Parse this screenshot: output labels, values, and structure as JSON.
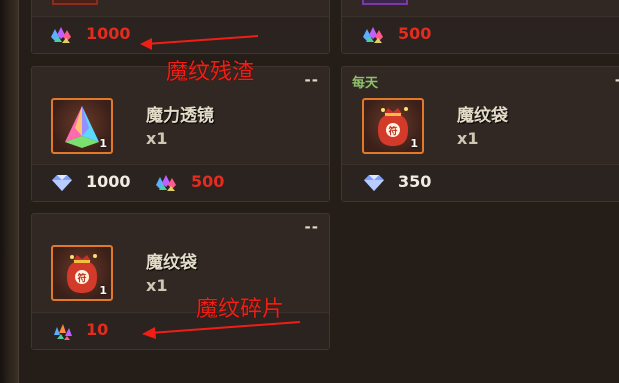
{
  "top_row": {
    "left_cost": "1000",
    "right_cost": "500"
  },
  "items": [
    {
      "name": "魔力透镜",
      "qty_badge": "1",
      "count": "x1",
      "header": "--",
      "cost_diamond": "1000",
      "cost_residue": "500",
      "icon": "prism-icon"
    },
    {
      "name": "魔纹袋",
      "qty_badge": "1",
      "count": "x1",
      "header": "每天",
      "header_right": "-",
      "cost_diamond": "350",
      "icon": "rune-bag-icon"
    },
    {
      "name": "魔纹袋",
      "qty_badge": "1",
      "count": "x1",
      "header": "--",
      "cost_fragment": "10",
      "icon": "rune-bag-icon"
    }
  ],
  "annotations": {
    "residue_label": "魔纹残渣",
    "fragment_label": "魔纹碎片"
  },
  "colors": {
    "price_red": "#e52b1e",
    "daily_green": "#8ec06a",
    "frame_orange": "#e07a2a",
    "annotation_red": "#f01e14"
  }
}
